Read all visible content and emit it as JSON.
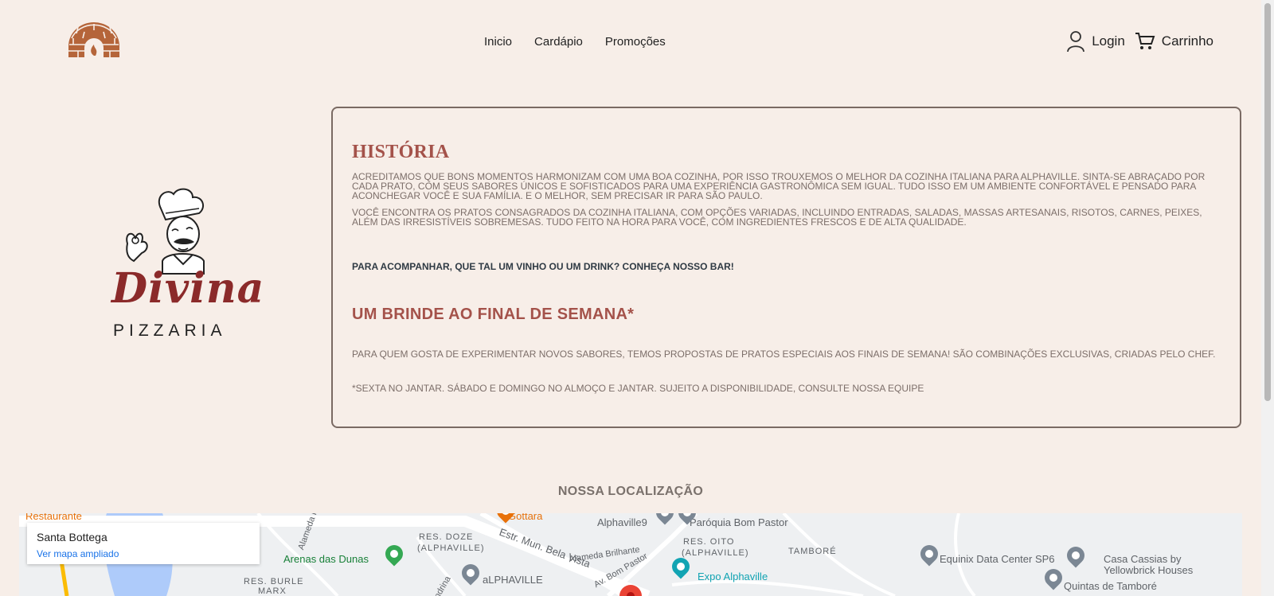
{
  "header": {
    "nav": [
      "Inicio",
      "Cardápio",
      "Promoções"
    ],
    "login_label": "Login",
    "cart_label": "Carrinho"
  },
  "brand": {
    "name": "Divina",
    "subtitle": "PIZZARIA"
  },
  "story": {
    "title": "HISTÓRIA",
    "paragraph1": "ACREDITAMOS QUE BONS MOMENTOS HARMONIZAM COM UMA BOA COZINHA, POR ISSO TROUXEMOS O MELHOR DA COZINHA ITALIANA PARA ALPHAVILLE. SINTA-SE ABRAÇADO POR CADA PRATO, COM SEUS SABORES ÚNICOS E SOFISTICADOS PARA UMA EXPERIÊNCIA GASTRONÔMICA SEM IGUAL. TUDO ISSO EM UM AMBIENTE CONFORTÁVEL E PENSADO PARA ACONCHEGAR VOCÊ E SUA FAMÍLIA. E O MELHOR, SEM PRECISAR IR PARA SÃO PAULO.",
    "paragraph2": "VOCÊ ENCONTRA OS PRATOS CONSAGRADOS DA COZINHA ITALIANA, COM OPÇÕES VARIADAS, INCLUINDO ENTRADAS, SALADAS, MASSAS ARTESANAIS, RISOTOS, CARNES, PEIXES, ALÉM DAS IRRESISTÍVEIS SOBREMESAS. TUDO FEITO NA HORA PARA VOCÊ, COM INGREDIENTES FRESCOS E DE ALTA QUALIDADE.",
    "bar_cta": "PARA ACOMPANHAR, QUE TAL UM VINHO OU UM DRINK? CONHEÇA NOSSO BAR!",
    "weekend_title": "UM BRINDE AO FINAL DE SEMANA*",
    "paragraph3": "PARA QUEM GOSTA DE EXPERIMENTAR NOVOS SABORES, TEMOS PROPOSTAS DE PRATOS ESPECIAIS AOS FINAIS DE SEMANA! SÃO COMBINAÇÕES EXCLUSIVAS, CRIADAS PELO CHEF.",
    "footnote": "*SEXTA NO JANTAR. SÁBADO E DOMINGO NO ALMOÇO E JANTAR. SUJEITO A DISPONIBILIDADE, CONSULTE NOSSA EQUIPE"
  },
  "location": {
    "title": "NOSSA LOCALIZAÇÃO",
    "place_name": "Santa Bottega",
    "map_link": "Ver mapa ampliado",
    "map_labels": {
      "restaurante": "Restaurante",
      "gottara": "Gottara",
      "alphaville9": "Alphaville9",
      "paroquia": "Paróquia Bom Pastor",
      "res_doze": "RES. DOZE",
      "res_doze_sub": "(ALPHAVILLE)",
      "arenas": "Arenas das Dunas",
      "estr": "Estr. Mun. Bela Vista",
      "alameda_brilhante": "Alameda Brilhante",
      "av_bom_pastor": "Av. Bom Pastor",
      "res_oito": "RES. OITO",
      "res_oito_sub": "(ALPHAVILLE)",
      "tambore": "TAMBORÉ",
      "equinix": "Equinix Data Center SP6",
      "casa_cassias": "Casa Cassias by",
      "casa_cassias_2": "Yellowbrick Houses",
      "expo": "Expo Alphaville",
      "alphaville_lower": "aLPHAVILLE",
      "res_burle": "RES. BURLE",
      "res_burle_2": "MARX",
      "quintas": "Quintas de Tamboré",
      "alameda_r": "Alameda R",
      "andrina": "ondrina"
    }
  },
  "colors": {
    "background": "#f7eee8",
    "accent": "#a4524a",
    "brand_red": "#8b2a2a",
    "oven": "#b5653a"
  }
}
